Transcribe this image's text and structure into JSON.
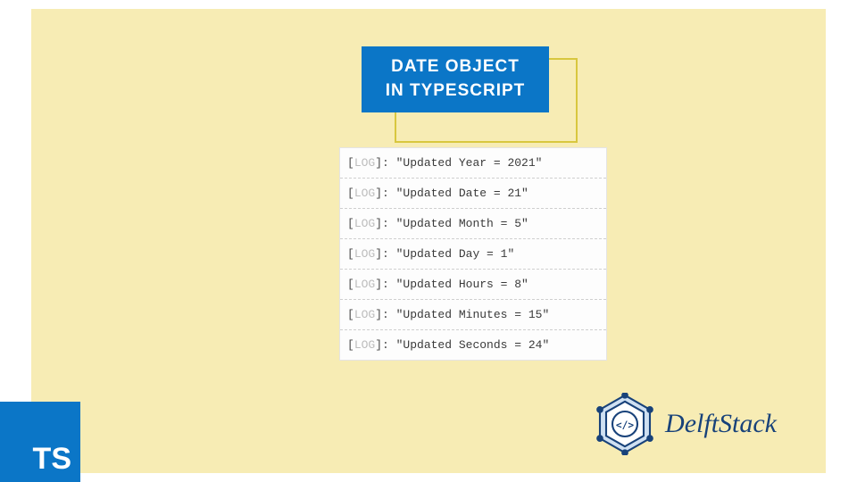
{
  "title": {
    "line1": "DATE OBJECT",
    "line2": "IN TYPESCRIPT"
  },
  "log": {
    "tag": "LOG",
    "rows": [
      "\"Updated Year = 2021\"",
      "\"Updated Date = 21\"",
      "\"Updated Month = 5\"",
      "\"Updated Day = 1\"",
      "\"Updated Hours = 8\"",
      "\"Updated Minutes = 15\"",
      "\"Updated Seconds = 24\""
    ]
  },
  "ts_badge": "TS",
  "brand": "DelftStack"
}
